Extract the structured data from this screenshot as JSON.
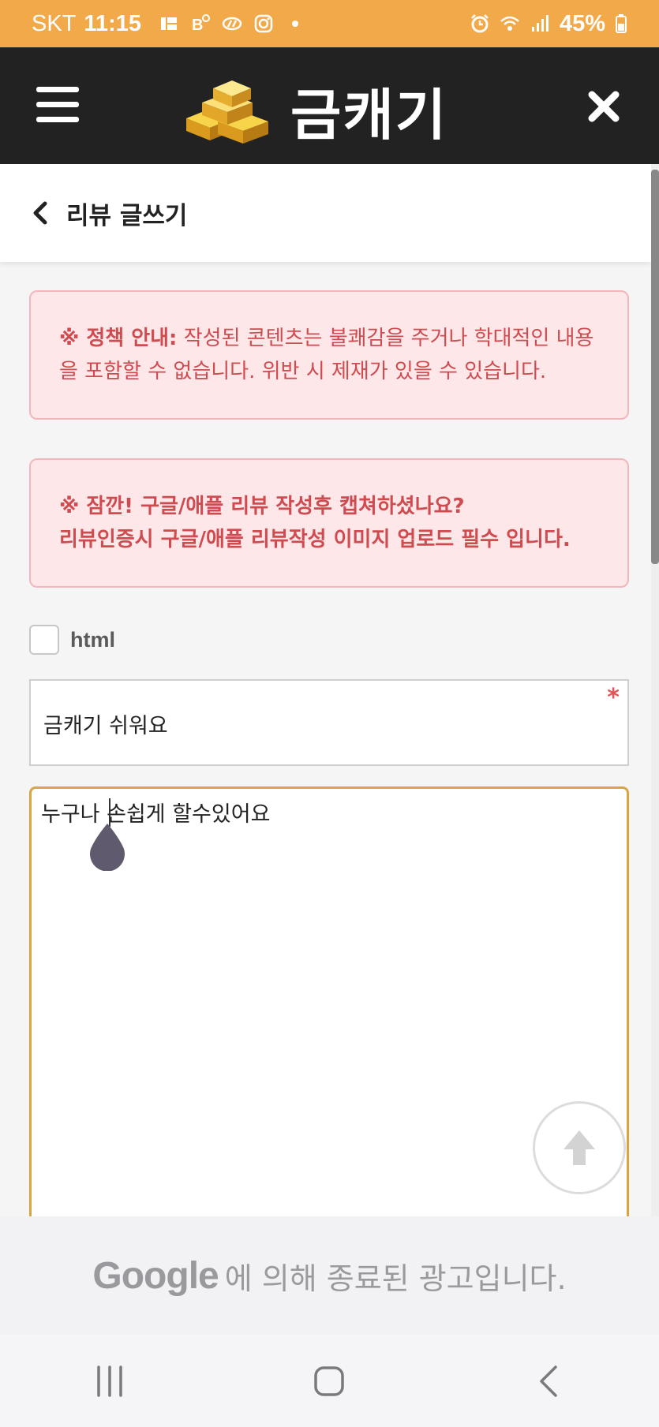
{
  "status_bar": {
    "carrier": "SKT",
    "time": "11:15",
    "battery": "45%"
  },
  "header": {
    "app_title": "금캐기"
  },
  "sub_header": {
    "title": "리뷰 글쓰기"
  },
  "alerts": {
    "policy_label": "※ 정책 안내:",
    "policy_text": "작성된 콘텐츠는 불쾌감을 주거나 학대적인 내용을 포함할 수 없습니다. 위반 시 제재가 있을 수 있습니다.",
    "notice_line1": "※ 잠깐! 구글/애플 리뷰 작성후 캡쳐하셨나요?",
    "notice_line2": "리뷰인증시 구글/애플 리뷰작성 이미지 업로드 필수 입니다."
  },
  "form": {
    "html_option_label": "html",
    "html_checked": false,
    "title_value": "금캐기 쉬워요",
    "required_mark": "*",
    "content_value": "누구나 손쉽게 할수있어요"
  },
  "ad": {
    "brand": "Google",
    "text": "에 의해 종료된 광고입니다."
  },
  "colors": {
    "status_bar_bg": "#f2a94a",
    "header_bg": "#222222",
    "alert_bg": "#fde7e9",
    "alert_text": "#cf4b4f",
    "textarea_focus_border": "#d9a443"
  },
  "icons": {
    "menu": "hamburger-icon",
    "logo": "gold-bars-icon",
    "close": "close-icon",
    "back": "chevron-left-icon",
    "scroll_top": "arrow-up-icon"
  }
}
